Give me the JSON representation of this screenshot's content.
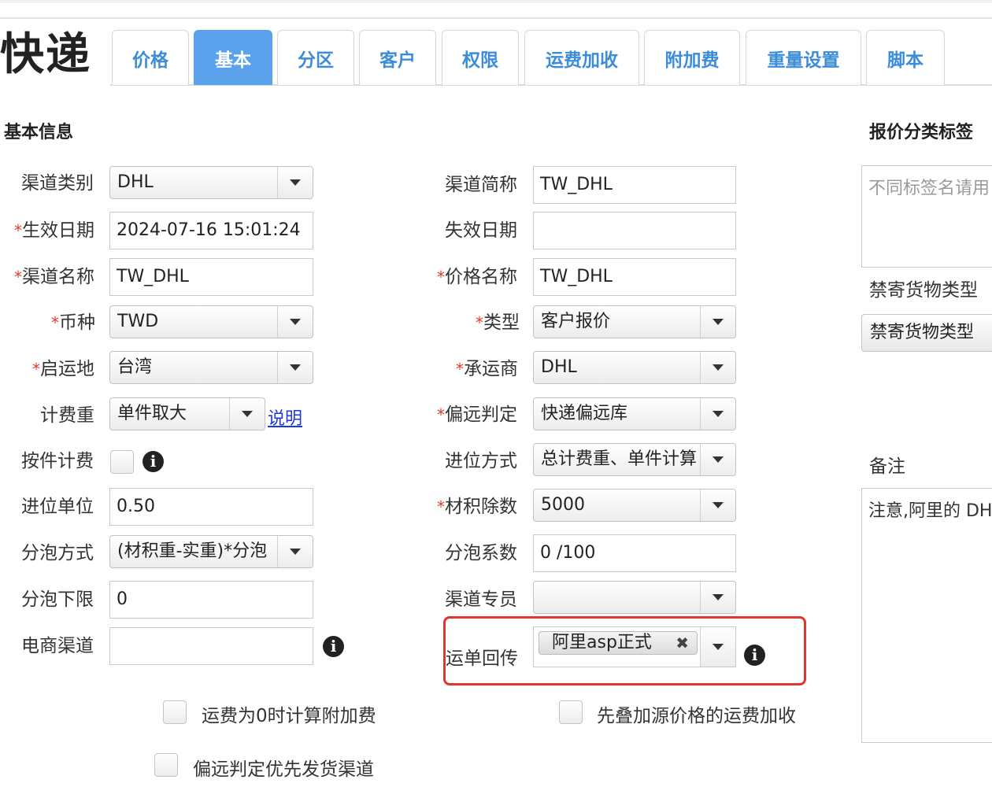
{
  "page": {
    "title": "快递"
  },
  "tabs": [
    {
      "label": "价格"
    },
    {
      "label": "基本"
    },
    {
      "label": "分区"
    },
    {
      "label": "客户"
    },
    {
      "label": "权限"
    },
    {
      "label": "运费加收"
    },
    {
      "label": "附加费"
    },
    {
      "label": "重量设置"
    },
    {
      "label": "脚本"
    }
  ],
  "active_tab": "基本",
  "basic_info": {
    "section_title": "基本信息",
    "required_mark": "*",
    "left_fields": {
      "channel_type": {
        "label": "渠道类别",
        "value": "DHL"
      },
      "effective_date": {
        "label": "生效日期",
        "value": "2024-07-16 15:01:24"
      },
      "channel_name": {
        "label": "渠道名称",
        "value": "TW_DHL"
      },
      "currency": {
        "label": "币种",
        "value": "TWD"
      },
      "origin": {
        "label": "启运地",
        "value": "台湾"
      },
      "billing_weight": {
        "label": "计费重",
        "value": "单件取大",
        "link": "说明"
      },
      "per_piece_billing": {
        "label": "按件计费"
      },
      "rounding_unit": {
        "label": "进位单位",
        "value": "0.50"
      },
      "bubble_method": {
        "label": "分泡方式",
        "value": "(材积重-实重)*分泡"
      },
      "bubble_lower_limit": {
        "label": "分泡下限",
        "value": "0"
      },
      "ecommerce_channel": {
        "label": "电商渠道",
        "value": ""
      }
    },
    "right_fields": {
      "channel_short_name": {
        "label": "渠道简称",
        "value": "TW_DHL"
      },
      "expiry_date": {
        "label": "失效日期",
        "value": ""
      },
      "price_name": {
        "label": "价格名称",
        "value": "TW_DHL"
      },
      "type": {
        "label": "类型",
        "value": "客户报价"
      },
      "carrier": {
        "label": "承运商",
        "value": "DHL"
      },
      "remote_judgement": {
        "label": "偏远判定",
        "value": "快递偏远库"
      },
      "rounding_method": {
        "label": "进位方式",
        "value": "总计费重、单件计算"
      },
      "volume_divisor": {
        "label": "材积除数",
        "value": "5000"
      },
      "bubble_coefficient": {
        "label": "分泡系数",
        "value": "0 /100"
      },
      "channel_specialist": {
        "label": "渠道专员",
        "value": ""
      },
      "waybill_return": {
        "label": "运单回传",
        "tag": "阿里asp正式",
        "tag_remove": "✖"
      }
    },
    "checkboxes": {
      "surcharge_when_zero": "运费为0时计算附加费",
      "stack_source_price": "先叠加源价格的运费加收",
      "remote_priority": "偏远判定优先发货渠道"
    }
  },
  "side_panel": {
    "quote_tags": {
      "title": "报价分类标签",
      "placeholder": "不同标签名请用"
    },
    "forbidden_goods": {
      "label": "禁寄货物类型",
      "button": "禁寄货物类型"
    },
    "remarks": {
      "label": "备注",
      "value": "注意,阿里的 DH"
    }
  },
  "icons": {
    "info": "info-icon",
    "dropdown": "chevron-down-icon",
    "remove_tag": "close-icon"
  },
  "colors": {
    "tab_active_bg": "#5aa2ec",
    "tab_text": "#3c8dd9",
    "required": "#e23b2e",
    "highlight_border": "#e2362c",
    "link": "#1a39e6"
  }
}
